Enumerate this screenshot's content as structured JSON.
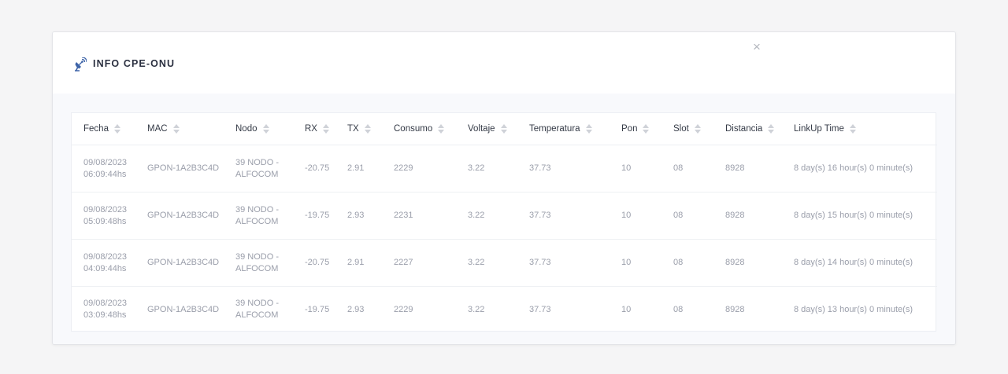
{
  "modal": {
    "title": "INFO CPE-ONU",
    "icon": "satellite-dish-icon",
    "close_label": "×"
  },
  "table": {
    "columns": [
      "Fecha",
      "MAC",
      "Nodo",
      "RX",
      "TX",
      "Consumo",
      "Voltaje",
      "Temperatura",
      "Pon",
      "Slot",
      "Distancia",
      "LinkUp Time"
    ],
    "rows": [
      {
        "fecha_date": "09/08/2023",
        "fecha_time": "06:09:44hs",
        "mac": "GPON-1A2B3C4D",
        "nodo_line1": "39 NODO -",
        "nodo_line2": "ALFOCOM",
        "rx": "-20.75",
        "tx": "2.91",
        "consumo": "2229",
        "voltaje": "3.22",
        "temperatura": "37.73",
        "pon": "10",
        "slot": "08",
        "distancia": "8928",
        "linkup": "8 day(s) 16 hour(s) 0 minute(s)"
      },
      {
        "fecha_date": "09/08/2023",
        "fecha_time": "05:09:48hs",
        "mac": "GPON-1A2B3C4D",
        "nodo_line1": "39 NODO -",
        "nodo_line2": "ALFOCOM",
        "rx": "-19.75",
        "tx": "2.93",
        "consumo": "2231",
        "voltaje": "3.22",
        "temperatura": "37.73",
        "pon": "10",
        "slot": "08",
        "distancia": "8928",
        "linkup": "8 day(s) 15 hour(s) 0 minute(s)"
      },
      {
        "fecha_date": "09/08/2023",
        "fecha_time": "04:09:44hs",
        "mac": "GPON-1A2B3C4D",
        "nodo_line1": "39 NODO -",
        "nodo_line2": "ALFOCOM",
        "rx": "-20.75",
        "tx": "2.91",
        "consumo": "2227",
        "voltaje": "3.22",
        "temperatura": "37.73",
        "pon": "10",
        "slot": "08",
        "distancia": "8928",
        "linkup": "8 day(s) 14 hour(s) 0 minute(s)"
      },
      {
        "fecha_date": "09/08/2023",
        "fecha_time": "03:09:48hs",
        "mac": "GPON-1A2B3C4D",
        "nodo_line1": "39 NODO -",
        "nodo_line2": "ALFOCOM",
        "rx": "-19.75",
        "tx": "2.93",
        "consumo": "2229",
        "voltaje": "3.22",
        "temperatura": "37.73",
        "pon": "10",
        "slot": "08",
        "distancia": "8928",
        "linkup": "8 day(s) 13 hour(s) 0 minute(s)"
      }
    ]
  },
  "colors": {
    "page_bg": "#f5f5f6",
    "title_text": "#2b3040",
    "icon_blue": "#3e64a8",
    "cell_text": "#9a9eaa",
    "header_text": "#343a46"
  }
}
